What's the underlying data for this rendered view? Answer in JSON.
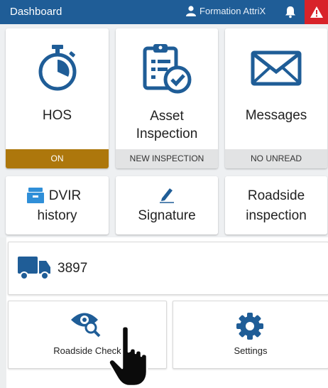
{
  "header": {
    "title": "Dashboard",
    "user_name": "Formation AttriX"
  },
  "tiles": {
    "hos": {
      "label": "HOS",
      "status": "ON"
    },
    "asset": {
      "label_line1": "Asset",
      "label_line2": "Inspection",
      "status": "NEW INSPECTION"
    },
    "messages": {
      "label": "Messages",
      "status": "NO UNREAD"
    },
    "dvir": {
      "label_line1": "DVIR",
      "label_line2": "history"
    },
    "signature": {
      "label": "Signature"
    },
    "roadside": {
      "label_line1": "Roadside",
      "label_line2": "inspection"
    }
  },
  "vehicle": {
    "number": "3897"
  },
  "bottom": {
    "roadside_check": "Roadside Check",
    "settings": "Settings"
  },
  "colors": {
    "header_blue": "#1f5d97",
    "alert_red": "#d8232a",
    "hos_on": "#ad770c",
    "icon_blue": "#1f5d97"
  }
}
